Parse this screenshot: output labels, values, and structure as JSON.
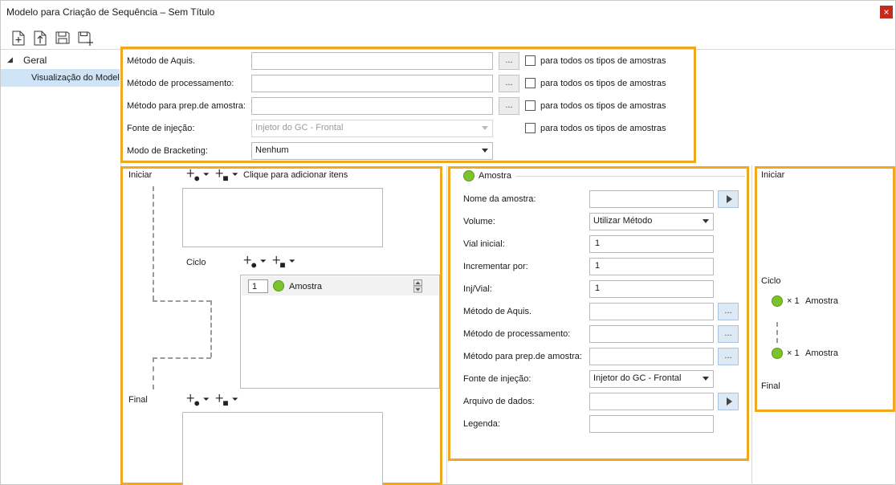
{
  "window": {
    "title": "Modelo para Criação de Sequência – Sem Título",
    "close_glyph": "×"
  },
  "toolbar": {
    "icons": [
      "new-icon",
      "import-icon",
      "save-icon",
      "save-as-icon"
    ]
  },
  "tree": {
    "root_label": "Geral",
    "child_label": "Visualização do Modelo"
  },
  "top_form": {
    "rows": [
      {
        "label": "Método de Aquis.",
        "value": "",
        "all_types_label": "para todos os tipos de amostras"
      },
      {
        "label": "Método de processamento:",
        "value": "",
        "all_types_label": "para todos os tipos de amostras"
      },
      {
        "label": "Método para prep.de amostra:",
        "value": "",
        "all_types_label": "para todos os tipos de amostras"
      },
      {
        "label": "Fonte de injeção:",
        "value": "Injetor do GC - Frontal",
        "all_types_label": "para todos os tipos de amostras"
      },
      {
        "label": "Modo de Bracketing:",
        "value": "Nenhum"
      }
    ],
    "dots_label": "..."
  },
  "sequence_editor": {
    "start_label": "Iniciar",
    "add_items_hint": "Clique para adicionar itens",
    "cycle_label": "Ciclo",
    "cycle_item": {
      "count": "1",
      "name": "Amostra"
    },
    "end_label": "Final"
  },
  "sample_props": {
    "header": "Amostra",
    "fields": [
      {
        "label": "Nome da amostra:",
        "value": ""
      },
      {
        "label": "Volume:",
        "value": "Utilizar Método"
      },
      {
        "label": "Vial inicial:",
        "value": "1"
      },
      {
        "label": "Incrementar por:",
        "value": "1"
      },
      {
        "label": "Inj/Vial:",
        "value": "1"
      },
      {
        "label": "Método de Aquis.",
        "value": ""
      },
      {
        "label": "Método de processamento:",
        "value": ""
      },
      {
        "label": "Método para prep.de amostra:",
        "value": ""
      },
      {
        "label": "Fonte de injeção:",
        "value": "Injetor do GC - Frontal"
      },
      {
        "label": "Arquivo de dados:",
        "value": ""
      },
      {
        "label": "Legenda:",
        "value": ""
      }
    ],
    "dots_label": "..."
  },
  "preview": {
    "start_label": "Iniciar",
    "cycle_label": "Ciclo",
    "items": [
      {
        "mult": "× 1",
        "name": "Amostra"
      },
      {
        "mult": "× 1",
        "name": "Amostra"
      }
    ],
    "end_label": "Final"
  },
  "colors": {
    "highlight": "#f0a81e",
    "sample_green": "#7cc22a",
    "selection": "#cfe5f7"
  }
}
